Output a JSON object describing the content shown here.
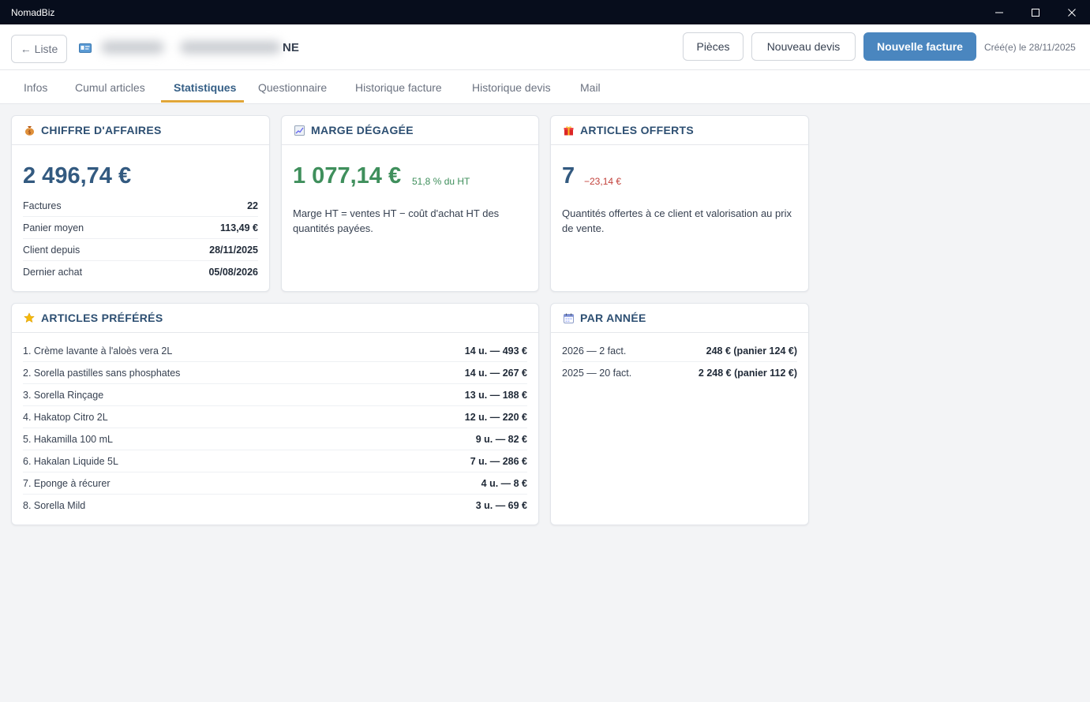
{
  "window": {
    "title": "NomadBiz",
    "controls": [
      "minimize",
      "maximize",
      "close"
    ]
  },
  "header": {
    "back_label": "← Liste",
    "client_name_visible_suffix": "NE",
    "pieces_label": "Pièces",
    "new_quote_label": "Nouveau devis",
    "new_invoice_label": "Nouvelle facture",
    "created_label": "Créé(e) le 28/11/2025"
  },
  "tabs": [
    {
      "label": "Infos",
      "active": false
    },
    {
      "label": "Cumul articles",
      "active": false
    },
    {
      "label": "Statistiques",
      "active": true
    },
    {
      "label": "Questionnaire",
      "active": false
    },
    {
      "label": "Historique facture",
      "active": false
    },
    {
      "label": "Historique devis",
      "active": false
    },
    {
      "label": "Mail",
      "active": false
    }
  ],
  "revenue": {
    "title": "CHIFFRE D'AFFAIRES",
    "icon": "money-bag-icon",
    "amount": "2 496,74 €",
    "rows": [
      {
        "label": "Factures",
        "value": "22"
      },
      {
        "label": "Panier moyen",
        "value": "113,49 €"
      },
      {
        "label": "Client depuis",
        "value": "28/11/2025"
      },
      {
        "label": "Dernier achat",
        "value": "05/08/2026"
      }
    ]
  },
  "margin": {
    "title": "MARGE DÉGAGÉE",
    "icon": "chart-up-icon",
    "amount": "1 077,14 €",
    "percent": "51,8 % du HT",
    "description": "Marge HT = ventes HT − coût d'achat HT des quantités payées."
  },
  "offered": {
    "title": "ARTICLES OFFERTS",
    "icon": "gift-icon",
    "count": "7",
    "value": "−23,14 €",
    "description": "Quantités offertes à ce client et valorisation au prix de vente."
  },
  "favorites": {
    "title": "ARTICLES PRÉFÉRÉS",
    "icon": "star-icon",
    "items": [
      {
        "label": "1. Crème lavante à l'aloès vera 2L",
        "value": "14 u. — 493 €"
      },
      {
        "label": "2. Sorella pastilles sans phosphates",
        "value": "14 u. — 267 €"
      },
      {
        "label": "3. Sorella Rinçage",
        "value": "13 u. — 188 €"
      },
      {
        "label": "4. Hakatop Citro 2L",
        "value": "12 u. — 220 €"
      },
      {
        "label": "5. Hakamilla 100 mL",
        "value": "9 u. — 82 €"
      },
      {
        "label": "6. Hakalan Liquide 5L",
        "value": "7 u. — 286 €"
      },
      {
        "label": "7. Eponge à récurer",
        "value": "4 u. — 8 €"
      },
      {
        "label": "8. Sorella Mild",
        "value": "3 u. — 69 €"
      }
    ]
  },
  "by_year": {
    "title": "PAR ANNÉE",
    "icon": "calendar-icon",
    "items": [
      {
        "label": "2026 — 2 fact.",
        "value": "248 € (panier 124 €)"
      },
      {
        "label": "2025 — 20 fact.",
        "value": "2 248 € (panier 112 €)"
      }
    ]
  },
  "colors": {
    "accent": "#4a86bf",
    "tab_underline": "#e0a638",
    "positive": "#3f8f5c",
    "negative": "#c2413b",
    "title_blue": "#2d4f72"
  }
}
